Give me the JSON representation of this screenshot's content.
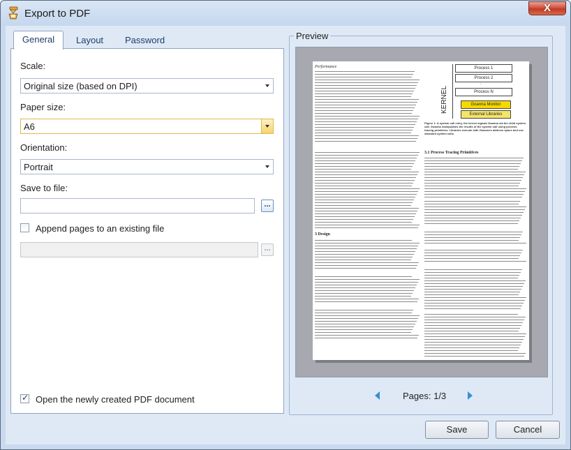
{
  "window": {
    "title": "Export to PDF",
    "close_glyph": "X",
    "close_icon": "close-icon",
    "app_icon": "export-pdf-app-icon"
  },
  "tabs": [
    {
      "label": "General"
    },
    {
      "label": "Layout"
    },
    {
      "label": "Password"
    }
  ],
  "general": {
    "scale": {
      "label": "Scale:",
      "value": "Original size (based on DPI)"
    },
    "paper_size": {
      "label": "Paper size:",
      "value": "A6"
    },
    "orientation": {
      "label": "Orientation:",
      "value": "Portrait"
    },
    "save_to_file": {
      "label": "Save to file:",
      "value": "",
      "browse_label": "..."
    },
    "append": {
      "label": "Append pages to an existing file",
      "checked": false,
      "value": "",
      "browse_label": "..."
    },
    "open_after": {
      "label": "Open the newly created PDF document",
      "checked": true
    }
  },
  "preview": {
    "title": "Preview",
    "pages_text": "Pages: 1/3",
    "page": {
      "section_performance": "Performance",
      "section_design": "3   Design",
      "section_process": "3.1   Process Tracing Primitives",
      "figure_boxes": [
        "Process 1",
        "Process 2",
        ":",
        "Process N"
      ],
      "kernel_label": "KERNEL",
      "ganna_monitor": "Goanna Monitor",
      "external_libraries": "External Libraries",
      "figure_caption": "Figure 1: A system call entry, the kernel signals Goanna via the child system call. Goanna manipulates the results of the system call using process tracing primitives. Libraries execute with Goanna's address space and use standard system calls."
    }
  },
  "buttons": {
    "save": "Save",
    "cancel": "Cancel"
  }
}
